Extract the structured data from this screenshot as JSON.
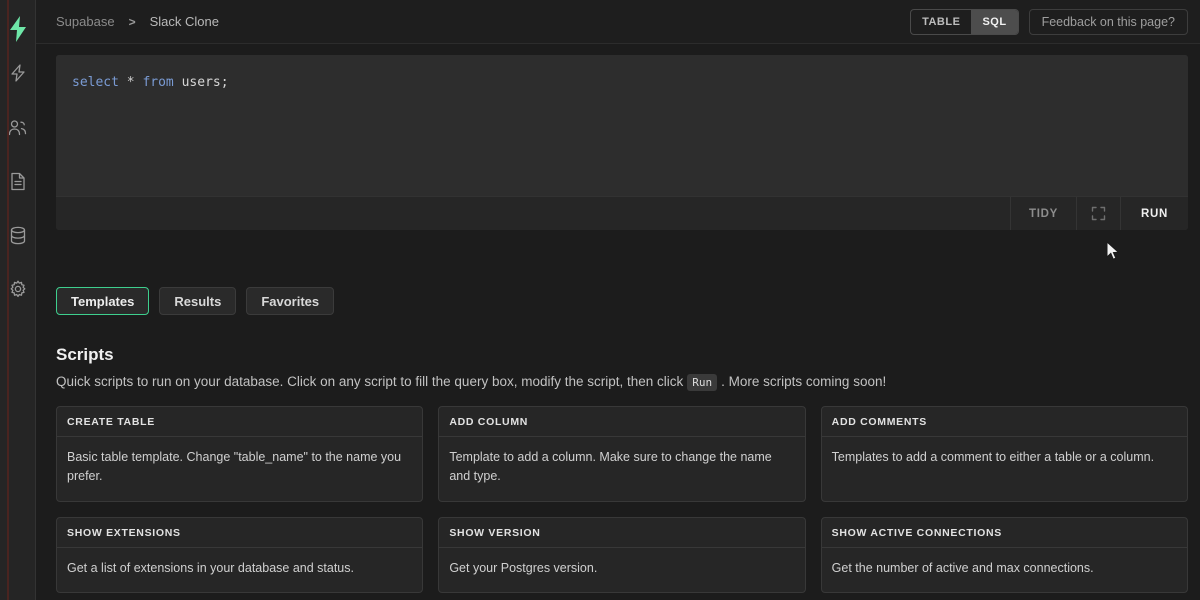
{
  "sidebar": {
    "logo_icon": "lightning-bolt-logo",
    "items": [
      {
        "icon": "lightning-bolt-icon",
        "name": "functions"
      },
      {
        "icon": "users-icon",
        "name": "authentication"
      },
      {
        "icon": "document-icon",
        "name": "table-editor"
      },
      {
        "icon": "database-icon",
        "name": "database"
      },
      {
        "icon": "gear-icon",
        "name": "settings"
      }
    ]
  },
  "header": {
    "breadcrumb": {
      "org": "Supabase",
      "separator": ">",
      "project": "Slack Clone"
    },
    "view_toggle": {
      "options": [
        "TABLE",
        "SQL"
      ],
      "table_label": "TABLE",
      "sql_label": "SQL",
      "selected": "SQL"
    },
    "feedback_label": "Feedback on this page?"
  },
  "editor": {
    "query": {
      "select_kw": "select",
      "star": "*",
      "from_kw": "from",
      "table": "users;"
    },
    "query_full": "select * from users;",
    "toolbar": {
      "tidy_label": "TIDY",
      "expand_icon": "fullscreen-icon",
      "run_label": "RUN"
    }
  },
  "tabs": [
    {
      "label": "Templates",
      "active": true
    },
    {
      "label": "Results",
      "active": false
    },
    {
      "label": "Favorites",
      "active": false
    }
  ],
  "scripts": {
    "title": "Scripts",
    "description_before": "Quick scripts to run on your database. Click on any script to fill the query box, modify the script, then click",
    "description_chip": "Run",
    "description_after": ". More scripts coming soon!",
    "cards": [
      {
        "title": "CREATE TABLE",
        "body": "Basic table template. Change \"table_name\" to the name you prefer."
      },
      {
        "title": "ADD COLUMN",
        "body": "Template to add a column. Make sure to change the name and type."
      },
      {
        "title": "ADD COMMENTS",
        "body": "Templates to add a comment to either a table or a column."
      },
      {
        "title": "SHOW EXTENSIONS",
        "body": "Get a list of extensions in your database and status."
      },
      {
        "title": "SHOW VERSION",
        "body": "Get your Postgres version."
      },
      {
        "title": "SHOW ACTIVE CONNECTIONS",
        "body": "Get the number of active and max connections."
      }
    ]
  },
  "colors": {
    "accent_green": "#3ecf8e",
    "page_bg": "#1c1c1c",
    "panel_bg": "#262626",
    "rail_bg": "#252525",
    "keyword_blue": "#7a9bd4"
  }
}
